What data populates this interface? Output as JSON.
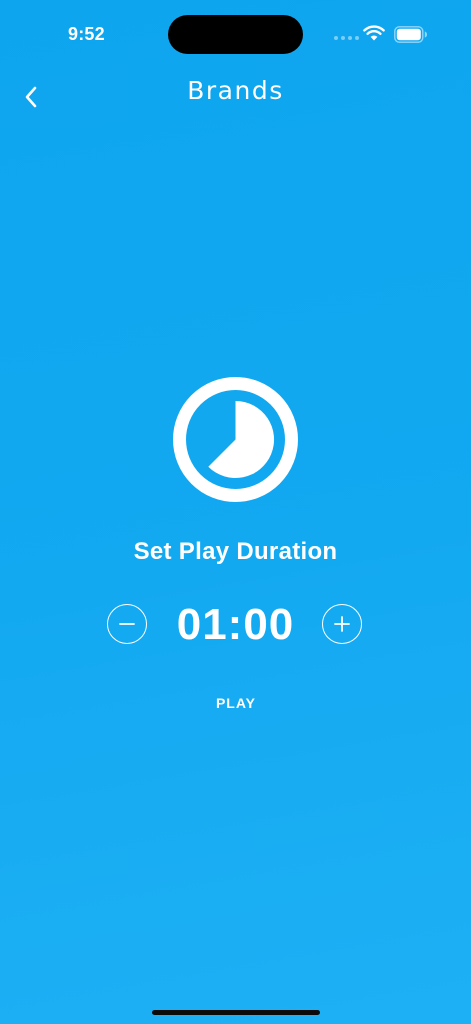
{
  "status_bar": {
    "time": "9:52",
    "icons": [
      "signal-dots-icon",
      "wifi-icon",
      "battery-icon"
    ]
  },
  "nav": {
    "back_icon": "chevron-left-icon",
    "title": "Brands"
  },
  "main": {
    "timer_icon": "timer-icon",
    "label": "Set Play Duration",
    "duration": "01:00",
    "decrement_icon": "minus-icon",
    "increment_icon": "plus-icon",
    "play_label": "PLAY"
  },
  "colors": {
    "background_top": "#0ea5ef",
    "background_bottom": "#1eb0f4",
    "foreground": "#ffffff"
  }
}
